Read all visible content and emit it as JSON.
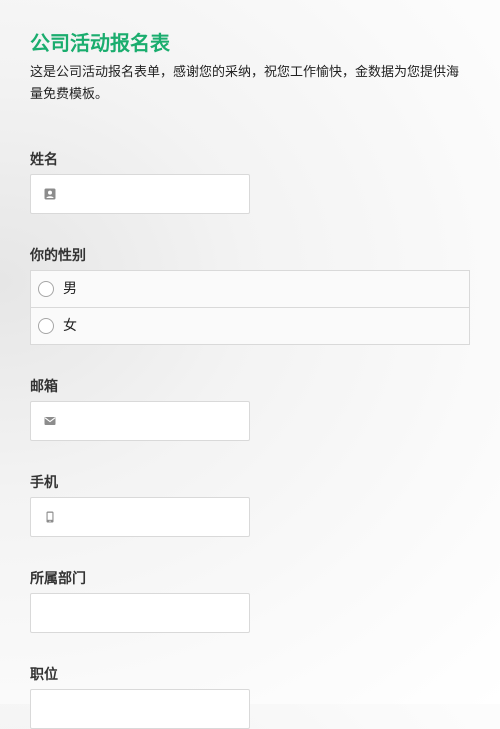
{
  "form": {
    "title": "公司活动报名表",
    "description": "这是公司活动报名表单，感谢您的采纳，祝您工作愉快，金数据为您提供海量免费模板。"
  },
  "fields": {
    "name": {
      "label": "姓名",
      "icon": "user-card-icon",
      "value": ""
    },
    "gender": {
      "label": "你的性别",
      "options": [
        "男",
        "女"
      ]
    },
    "email": {
      "label": "邮箱",
      "icon": "envelope-icon",
      "value": ""
    },
    "phone": {
      "label": "手机",
      "icon": "mobile-phone-icon",
      "value": ""
    },
    "department": {
      "label": "所属部门",
      "value": ""
    },
    "position": {
      "label": "职位",
      "value": ""
    }
  },
  "colors": {
    "accent": "#1aad6e",
    "border": "#d9d9d9",
    "icon": "#8c8c8c"
  }
}
